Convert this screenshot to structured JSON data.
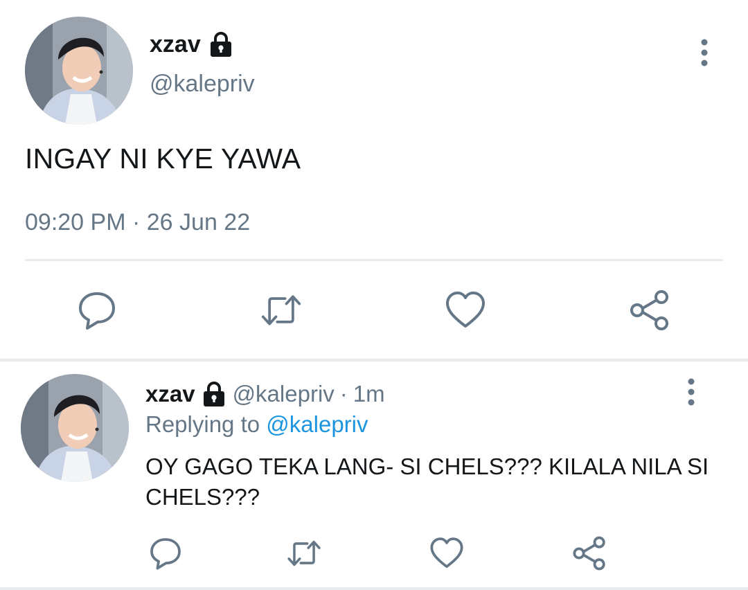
{
  "main_tweet": {
    "display_name": "xzav",
    "handle": "@kalepriv",
    "text": "INGAY NI KYE YAWA",
    "time": "09:20 PM",
    "separator": "·",
    "date": "26 Jun 22",
    "icons": {
      "lock": "lock-icon",
      "more": "vertical-dots-icon",
      "reply": "speech-bubble-icon",
      "retweet": "retweet-icon",
      "like": "heart-icon",
      "share": "share-icon"
    }
  },
  "reply_tweet": {
    "display_name": "xzav",
    "handle": "@kalepriv",
    "separator": "·",
    "time": "1m",
    "replying_to_label": "Replying to",
    "replying_to_handle": "@kalepriv",
    "text": "OY GAGO TEKA LANG- SI CHELS??? KILALA NILA SI CHELS???"
  },
  "colors": {
    "primary_text": "#14171a",
    "secondary_text": "#657786",
    "mention_link": "#1b95e0",
    "divider": "#e8ecef"
  }
}
